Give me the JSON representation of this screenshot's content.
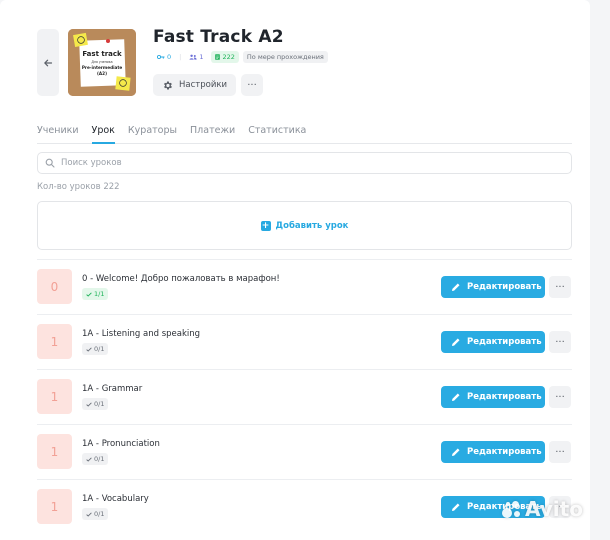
{
  "course": {
    "title": "Fast Track A2",
    "cover_text": {
      "line1": "Fast track",
      "line2": "Для ученика",
      "line3": "Pre-intermediate",
      "line4": "(A2)"
    },
    "stats": {
      "keys": "0",
      "students": "1",
      "lessons": "222",
      "mode": "По мере прохождения"
    },
    "settings_label": "Настройки",
    "more_label": "···"
  },
  "tabs": [
    {
      "label": "Ученики",
      "active": false
    },
    {
      "label": "Урок",
      "active": true
    },
    {
      "label": "Кураторы",
      "active": false
    },
    {
      "label": "Платежи",
      "active": false
    },
    {
      "label": "Статистика",
      "active": false
    }
  ],
  "search": {
    "placeholder": "Поиск уроков",
    "value": ""
  },
  "lesson_count": "Кол-во уроков 222",
  "add_lesson_label": "Добавить урок",
  "edit_label": "Редактировать",
  "lessons": [
    {
      "number": "0",
      "name": "0 - Welcome! Добро пожаловать в марафон!",
      "progress": "1/1",
      "done": true
    },
    {
      "number": "1",
      "name": "1A - Listening and speaking",
      "progress": "0/1",
      "done": false
    },
    {
      "number": "1",
      "name": "1A - Grammar",
      "progress": "0/1",
      "done": false
    },
    {
      "number": "1",
      "name": "1A - Pronunciation",
      "progress": "0/1",
      "done": false
    },
    {
      "number": "1",
      "name": "1A - Vocabulary",
      "progress": "0/1",
      "done": false
    }
  ],
  "watermark": "Avito",
  "icons": {
    "back": "arrow-left-icon",
    "gear": "gear-icon",
    "search": "search-icon",
    "pencil": "pencil-icon",
    "check": "check-icon"
  },
  "colors": {
    "accent": "#29abe2",
    "success": "#1fb35a",
    "number_bg": "#fde3df",
    "number_fg": "#f2a196"
  }
}
